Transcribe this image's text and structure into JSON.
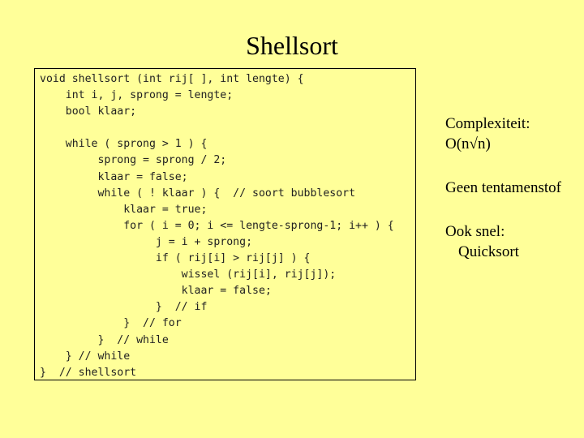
{
  "slide": {
    "title": "Shellsort",
    "code_lines": [
      "void shellsort (int rij[ ], int lengte) {",
      "    int i, j, sprong = lengte;",
      "    bool klaar;",
      "",
      "    while ( sprong > 1 ) {",
      "         sprong = sprong / 2;",
      "         klaar = false;",
      "         while ( ! klaar ) {  // soort bubblesort",
      "             klaar = true;",
      "             for ( i = 0; i <= lengte-sprong-1; i++ ) {",
      "                  j = i + sprong;",
      "                  if ( rij[i] > rij[j] ) {",
      "                      wissel (rij[i], rij[j]);",
      "                      klaar = false;",
      "                  }  // if",
      "             }  // for",
      "         }  // while",
      "    } // while",
      "}  // shellsort"
    ],
    "notes": {
      "complexity_label": "Complexiteit:",
      "complexity_value": "O(n√n)",
      "exam_note": "Geen tentamenstof",
      "also_fast_label": "Ook snel:",
      "also_fast_value": "Quicksort"
    }
  }
}
